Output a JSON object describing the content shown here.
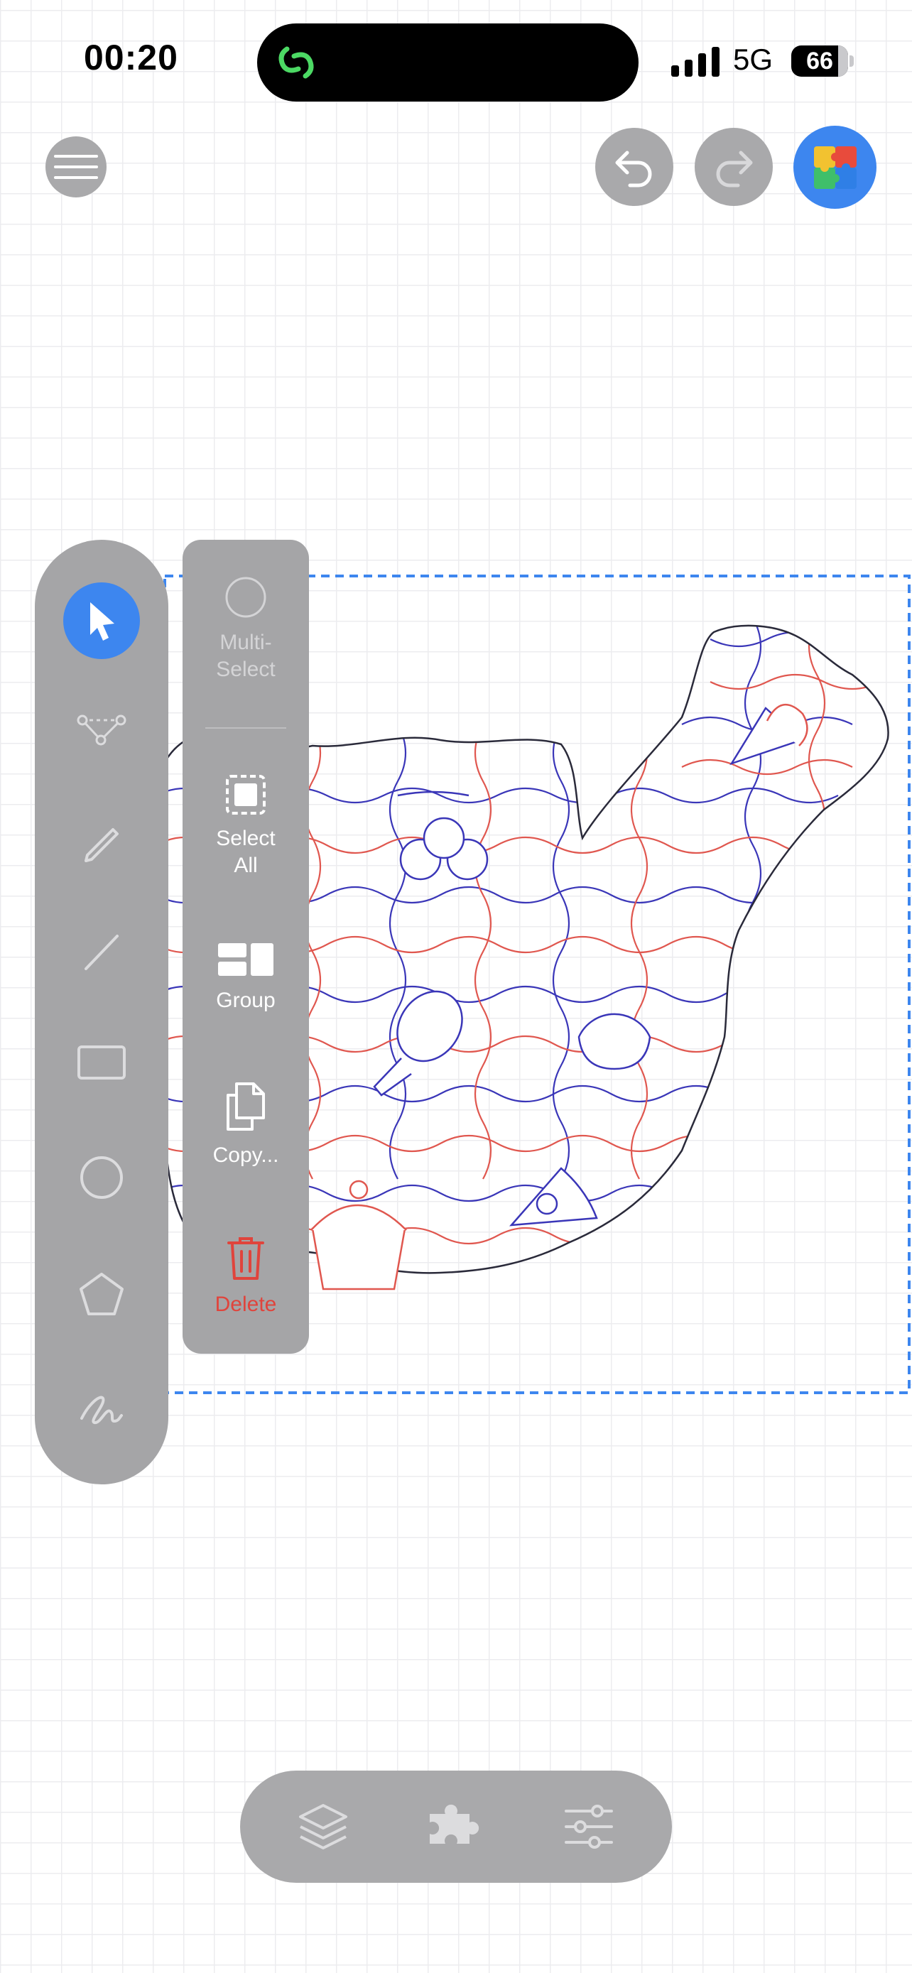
{
  "status_bar": {
    "time": "00:20",
    "network": "5G",
    "battery": "66",
    "icons": [
      "app-activity-icon",
      "signal-icon",
      "battery-icon"
    ]
  },
  "header": {
    "icons": [
      "menu-icon",
      "undo-icon",
      "redo-icon",
      "puzzle-app-icon"
    ]
  },
  "toolbar": {
    "tools": [
      {
        "name": "select-tool",
        "icon": "pointer-icon",
        "active": true
      },
      {
        "name": "node-tool",
        "icon": "nodes-icon"
      },
      {
        "name": "pencil-tool",
        "icon": "pencil-icon"
      },
      {
        "name": "line-tool",
        "icon": "line-icon"
      },
      {
        "name": "rectangle-tool",
        "icon": "rectangle-icon"
      },
      {
        "name": "circle-tool",
        "icon": "circle-icon"
      },
      {
        "name": "polygon-tool",
        "icon": "pentagon-icon"
      },
      {
        "name": "freehand-tool",
        "icon": "scribble-icon"
      }
    ]
  },
  "context_menu": {
    "multi_select": "Multi-\nSelect",
    "select_all": "Select\nAll",
    "group": "Group",
    "copy": "Copy...",
    "delete": "Delete"
  },
  "bottom_bar": {
    "icons": [
      "layers-icon",
      "puzzle-piece-icon",
      "sliders-icon"
    ]
  },
  "colors": {
    "accent": "#3d86ef",
    "panel": "#a5a5a7",
    "delete": "#e0443c",
    "cut_blue": "#3a36b8",
    "cut_red": "#e0574f",
    "selection": "#3d86ef"
  }
}
